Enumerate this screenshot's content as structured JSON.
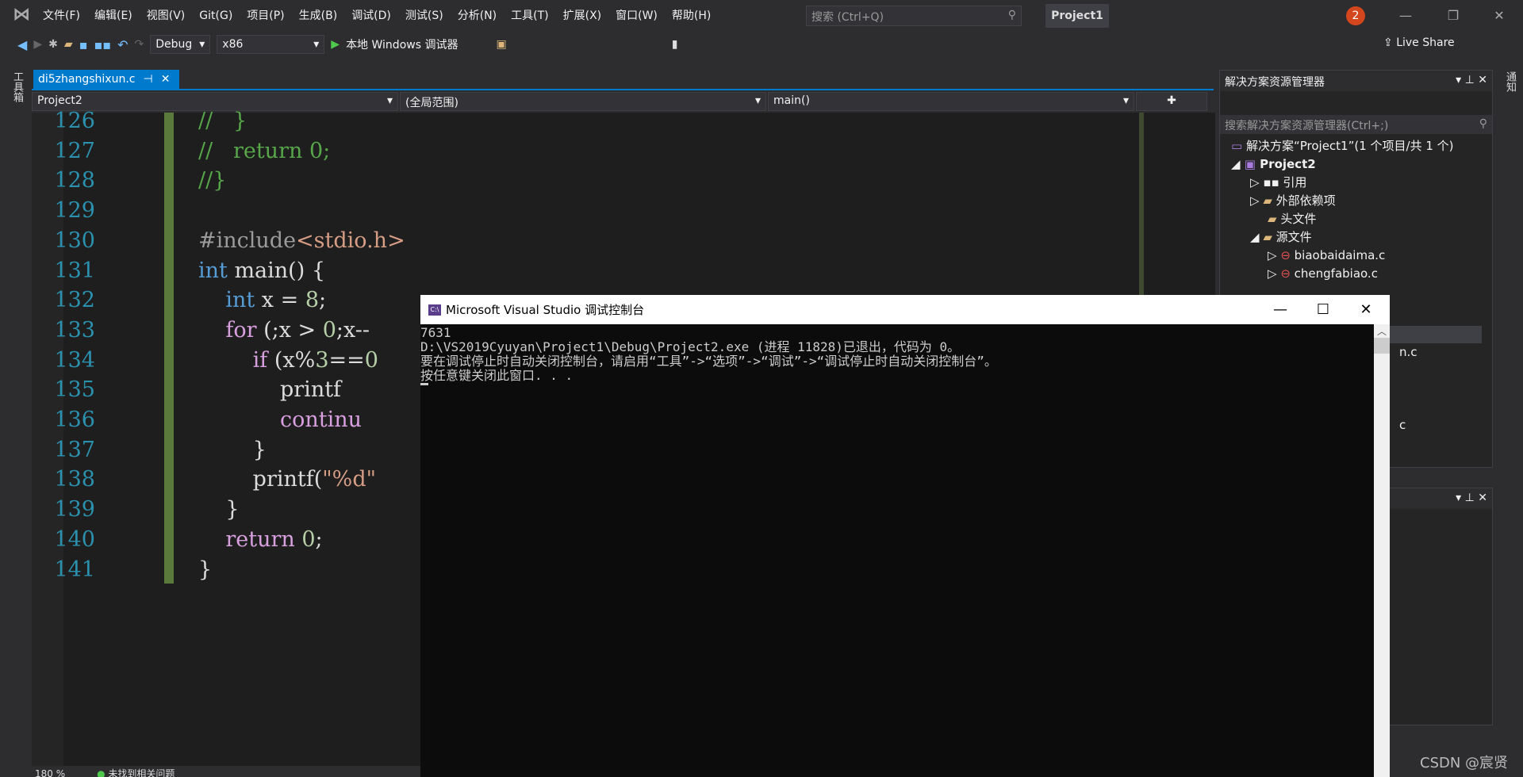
{
  "titlebar": {
    "menu": [
      "文件(F)",
      "编辑(E)",
      "视图(V)",
      "Git(G)",
      "项目(P)",
      "生成(B)",
      "调试(D)",
      "测试(S)",
      "分析(N)",
      "工具(T)",
      "扩展(X)",
      "窗口(W)",
      "帮助(H)"
    ],
    "search_placeholder": "搜索 (Ctrl+Q)",
    "project": "Project1",
    "notifications": "2"
  },
  "toolbar": {
    "config": "Debug",
    "platform": "x86",
    "run": "本地 Windows 调试器",
    "live_share": "Live Share"
  },
  "left_strip": "工具箱",
  "right_strip": "通知",
  "tab": {
    "name": "di5zhangshixun.c"
  },
  "navbar": {
    "project": "Project2",
    "scope": "(全局范围)",
    "member": "main()"
  },
  "editor": {
    "lines": [
      {
        "n": "126",
        "html": "<span class='cm'>//   }</span>"
      },
      {
        "n": "127",
        "html": "<span class='cm'>//   return 0;</span>"
      },
      {
        "n": "128",
        "html": "<span class='cm'>//}</span>"
      },
      {
        "n": "129",
        "html": ""
      },
      {
        "n": "130",
        "html": "<span class='pp'>#include</span><span class='str'>&lt;stdio.h&gt;</span>"
      },
      {
        "n": "131",
        "html": "<span class='kw'>int</span> main() {"
      },
      {
        "n": "132",
        "html": "    <span class='kw'>int</span> x = <span class='num'>8</span>;"
      },
      {
        "n": "133",
        "html": "    <span class='ctl'>for</span> (;x &gt; <span class='num'>0</span>;x--"
      },
      {
        "n": "134",
        "html": "        <span class='ctl'>if</span> (x%<span class='num'>3</span>==<span class='num'>0</span>"
      },
      {
        "n": "135",
        "html": "            printf"
      },
      {
        "n": "136",
        "html": "            <span class='ctl'>continu</span>"
      },
      {
        "n": "137",
        "html": "        }"
      },
      {
        "n": "138",
        "html": "        printf(<span class='str'>\"%d\"</span>"
      },
      {
        "n": "139",
        "html": "    }"
      },
      {
        "n": "140",
        "html": "    <span class='ctl'>return</span> <span class='num'>0</span>;"
      },
      {
        "n": "141",
        "html": "}"
      }
    ]
  },
  "console": {
    "title": "Microsoft Visual Studio 调试控制台",
    "output": [
      "7631",
      "D:\\VS2019Cyuyan\\Project1\\Debug\\Project2.exe (进程 11828)已退出，代码为 0。",
      "要在调试停止时自动关闭控制台，请启用“工具”->“选项”->“调试”->“调试停止时自动关闭控制台”。",
      "按任意键关闭此窗口. . ."
    ]
  },
  "solution_explorer": {
    "title": "解决方案资源管理器",
    "search_placeholder": "搜索解决方案资源管理器(Ctrl+;)",
    "solution": "解决方案“Project1”(1 个项目/共 1 个)",
    "project": "Project2",
    "items": [
      "引用",
      "外部依赖项",
      "头文件",
      "源文件"
    ],
    "files": [
      "biaobaidaima.c",
      "chengfabiao.c"
    ],
    "partial": [
      "n.c",
      "c"
    ]
  },
  "status": {
    "zoom": "180 %",
    "issues": "未找到相关问题"
  },
  "watermark": "CSDN @宸贤"
}
